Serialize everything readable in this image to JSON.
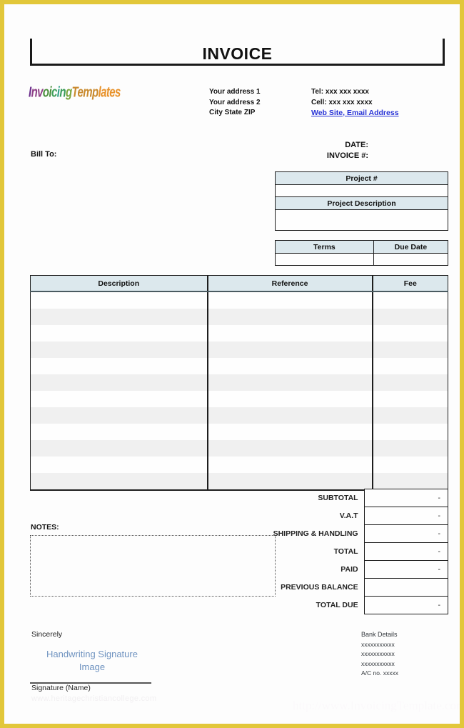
{
  "document": {
    "title": "INVOICE",
    "logo": {
      "segments": [
        "I",
        "nv",
        "oi",
        "c",
        "i",
        "n",
        "g",
        "Temp",
        "lates"
      ],
      "full_text": "InvoicingTemplates"
    }
  },
  "sender": {
    "address": [
      "Your address 1",
      "Your address 2",
      "City State ZIP"
    ],
    "tel": "Tel: xxx xxx xxxx",
    "cell": "Cell: xxx xxx xxxx",
    "weblink": "Web Site, Email Address"
  },
  "bill": {
    "bill_to_label": "Bill To:",
    "date_label": "DATE:",
    "invoice_no_label": "INVOICE #:"
  },
  "project": {
    "number_header": "Project #",
    "number_value": "",
    "description_header": "Project Description",
    "description_value": ""
  },
  "terms": {
    "terms_header": "Terms",
    "terms_value": "",
    "due_date_header": "Due Date",
    "due_date_value": ""
  },
  "items": {
    "columns": [
      "Description",
      "Reference",
      "Fee"
    ],
    "row_count": 12
  },
  "totals": {
    "rows": [
      {
        "label": "SUBTOTAL",
        "value": "-"
      },
      {
        "label": "V.A.T",
        "value": "-"
      },
      {
        "label": "SHIPPING & HANDLING",
        "value": "-"
      },
      {
        "label": "TOTAL",
        "value": "-"
      },
      {
        "label": "PAID",
        "value": "-"
      },
      {
        "label": "PREVIOUS BALANCE",
        "value": ""
      },
      {
        "label": "TOTAL DUE",
        "value": "-"
      }
    ]
  },
  "notes": {
    "label": "NOTES:",
    "value": ""
  },
  "signature": {
    "sincerely": "Sincerely",
    "image_line_1": "Handwriting Signature",
    "image_line_2": "Image",
    "name_label": "Signature (Name)"
  },
  "bank": {
    "title": "Bank Details",
    "lines": [
      "xxxxxxxxxxx",
      "xxxxxxxxxxx",
      "xxxxxxxxxxx",
      "A/C no. xxxxx"
    ]
  },
  "watermarks": {
    "left": "www.heritagechristiancollege.com",
    "right": "http://www.InvoicingTemplate.com"
  },
  "colors": {
    "page_border": "#e2c73a",
    "table_header_bg": "#dce8ed",
    "zebra_row_bg": "#f0f0f0",
    "link": "#2732d6",
    "signature_text": "#6f93c0"
  }
}
